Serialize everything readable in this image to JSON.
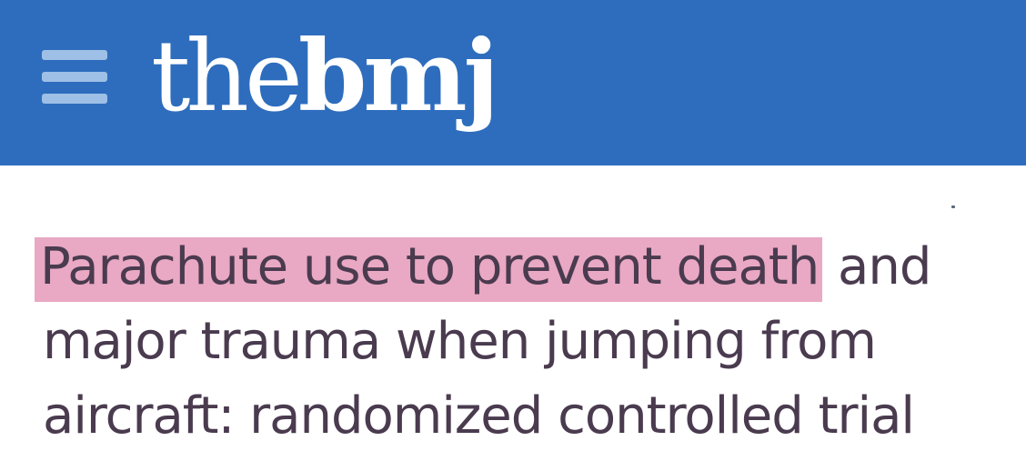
{
  "header": {
    "menu_icon": "hamburger-menu-icon",
    "logo": {
      "part1": "the",
      "part2": "bmj"
    },
    "background_color": "#2e6dbd"
  },
  "article": {
    "title_line1_highlighted": "Parachute use to prevent death",
    "title_line1_rest": " and",
    "title_line2": "major trauma when jumping from",
    "title_line3": "aircraft: randomized controlled trial",
    "highlight_color": "#e9a8c3",
    "text_color": "#4a3b4f"
  }
}
